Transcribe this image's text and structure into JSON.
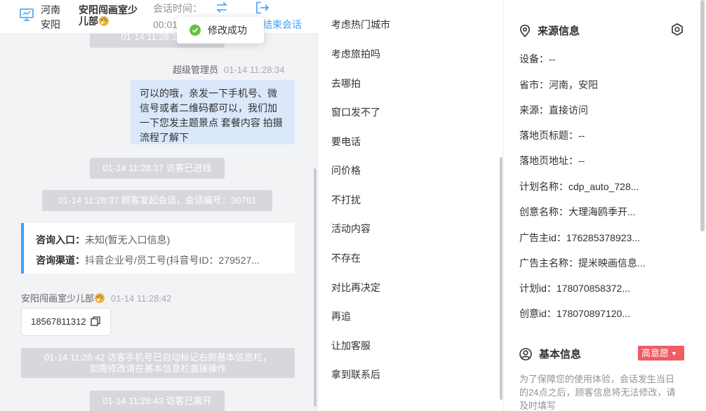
{
  "header": {
    "region_line1": "河南",
    "region_line2": "安阳",
    "name_line1": "安阳闯画室少",
    "name_line2": "儿部",
    "session_time_label": "会话时间：",
    "session_time_value": "00:01",
    "end_session_label": "结束会话"
  },
  "toast": {
    "text": "修改成功"
  },
  "messages": {
    "sys_top_partial": "01-14 11:28:33 访",
    "agent_sender": "超级管理员",
    "agent_time": "01-14 11:28:34",
    "agent_text": "可以的哦，亲发一下手机号、微信号或者二维码都可以，我们加一下您发主题景点 套餐内容 拍摄流程了解下",
    "sys_entered": "01-14 11:28:37 访客已进线",
    "sys_started": "01-14 11:28:37 顾客发起会话，会话编号：30701",
    "card_entry_label": "咨询入口：",
    "card_entry_value": "未知(暂无入口信息)",
    "card_channel_label": "咨询渠道：",
    "card_channel_value": "抖音企业号/员工号(抖音号ID：279527...",
    "visitor_sender": "安阳闯画室少儿部",
    "visitor_time": "01-14 11:28:42",
    "visitor_phone": "18567811312",
    "sys_phone_note_line1": "01-14 11:28:42 访客手机号已自动标记右侧基本信息栏，",
    "sys_phone_note_line2": "如需修改请在基本信息栏直接操作",
    "sys_left": "01-14 11:28:43 访客已离开"
  },
  "quick_replies": [
    "考虑热门城市",
    "考虑旅拍吗",
    "去哪拍",
    "窗口发不了",
    "要电话",
    "问价格",
    "不打扰",
    "活动内容",
    "不存在",
    "对比再决定",
    "再追",
    "让加客服",
    "拿到联系后"
  ],
  "source_info": {
    "title": "来源信息",
    "rows": [
      "设备：--",
      "省市：河南，安阳",
      "来源：直接访问",
      "落地页标题：--",
      "落地页地址：--",
      "计划名称：cdp_auto_728...",
      "创意名称：大理海鸥季开...",
      "广告主id：176285378923...",
      "广告主名称：提米映画信息...",
      "计划id：178070858372...",
      "创意id：178070897120..."
    ]
  },
  "basic_info": {
    "title": "基本信息",
    "intent_badge": "高意愿",
    "notice": "为了保障您的使用体验，会话发生当日的24点之后，顾客信息将无法修改，请及时填写"
  },
  "colors": {
    "accent": "#409eff",
    "agent_bubble": "#dbe8fb",
    "system_pill": "#d6d8dc",
    "badge_red": "#f05b66",
    "success_green": "#67c23a"
  }
}
